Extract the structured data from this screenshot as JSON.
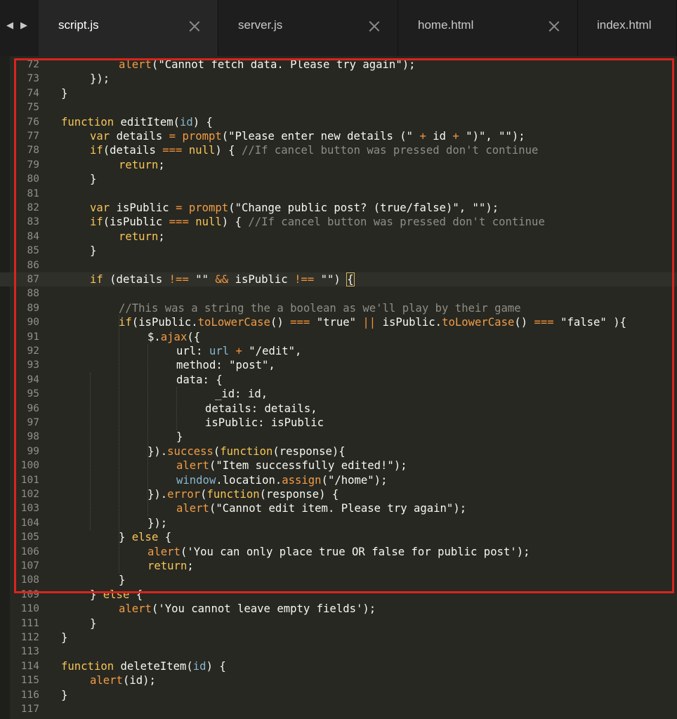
{
  "tabs": [
    {
      "label": "script.js",
      "active": true
    },
    {
      "label": "server.js",
      "active": false
    },
    {
      "label": "home.html",
      "active": false
    },
    {
      "label": "index.html",
      "active": false
    }
  ],
  "nav": {
    "back": "◀",
    "forward": "▶"
  },
  "colors": {
    "keyword": "#f8c555",
    "function": "#f39c45",
    "comment": "#8e8e85",
    "highlight": "#d8251d",
    "background": "#272822"
  },
  "lines": [
    {
      "n": "72",
      "segs": [
        [
          "f",
          "alert"
        ],
        [
          "s",
          "(\"Cannot fetch data. Please try again\");"
        ]
      ]
    },
    {
      "n": "73",
      "segs": [
        [
          "s",
          "});"
        ]
      ]
    },
    {
      "n": "74",
      "segs": [
        [
          "s",
          "}"
        ]
      ]
    },
    {
      "n": "75",
      "segs": []
    },
    {
      "n": "76",
      "segs": [
        [
          "k",
          "function "
        ],
        [
          "s",
          "editItem("
        ],
        [
          "p",
          "id"
        ],
        [
          "s",
          ") {"
        ]
      ]
    },
    {
      "n": "77",
      "segs": [
        [
          "k",
          "var "
        ],
        [
          "s",
          "details "
        ],
        [
          "o",
          "= "
        ],
        [
          "f",
          "prompt"
        ],
        [
          "s",
          "(\"Please enter new details (\" "
        ],
        [
          "o",
          "+ "
        ],
        [
          "s",
          "id "
        ],
        [
          "o",
          "+ "
        ],
        [
          "s",
          "\")\", \"\");"
        ]
      ]
    },
    {
      "n": "78",
      "segs": [
        [
          "k",
          "if"
        ],
        [
          "s",
          "(details "
        ],
        [
          "o",
          "=== "
        ],
        [
          "k",
          "null"
        ],
        [
          "s",
          ") { "
        ],
        [
          "c",
          "//If cancel button was pressed don't continue"
        ]
      ]
    },
    {
      "n": "79",
      "segs": [
        [
          "k",
          "return"
        ],
        [
          "s",
          ";"
        ]
      ]
    },
    {
      "n": "80",
      "segs": [
        [
          "s",
          "}"
        ]
      ]
    },
    {
      "n": "81",
      "segs": []
    },
    {
      "n": "82",
      "segs": [
        [
          "k",
          "var "
        ],
        [
          "s",
          "isPublic "
        ],
        [
          "o",
          "= "
        ],
        [
          "f",
          "prompt"
        ],
        [
          "s",
          "(\"Change public post? (true/false)\", \"\");"
        ]
      ]
    },
    {
      "n": "83",
      "segs": [
        [
          "k",
          "if"
        ],
        [
          "s",
          "(isPublic "
        ],
        [
          "o",
          "=== "
        ],
        [
          "k",
          "null"
        ],
        [
          "s",
          ") { "
        ],
        [
          "c",
          "//If cancel button was pressed don't continue"
        ]
      ]
    },
    {
      "n": "84",
      "segs": [
        [
          "k",
          "return"
        ],
        [
          "s",
          ";"
        ]
      ]
    },
    {
      "n": "85",
      "segs": [
        [
          "s",
          "}"
        ]
      ]
    },
    {
      "n": "86",
      "segs": []
    },
    {
      "n": "87",
      "segs": [
        [
          "k",
          "if "
        ],
        [
          "s",
          "(details "
        ],
        [
          "o",
          "!== "
        ],
        [
          "s",
          "\"\" "
        ],
        [
          "o",
          "&& "
        ],
        [
          "s",
          "isPublic "
        ],
        [
          "o",
          "!== "
        ],
        [
          "s",
          "\"\") "
        ],
        [
          "b",
          "{"
        ]
      ]
    },
    {
      "n": "88",
      "segs": []
    },
    {
      "n": "89",
      "segs": [
        [
          "c",
          "//This was a string the a boolean as we'll play by their game"
        ]
      ]
    },
    {
      "n": "90",
      "segs": [
        [
          "k",
          "if"
        ],
        [
          "s",
          "(isPublic."
        ],
        [
          "f",
          "toLowerCase"
        ],
        [
          "s",
          "() "
        ],
        [
          "o",
          "=== "
        ],
        [
          "s",
          "\"true\" "
        ],
        [
          "o",
          "|| "
        ],
        [
          "s",
          "isPublic."
        ],
        [
          "f",
          "toLowerCase"
        ],
        [
          "s",
          "() "
        ],
        [
          "o",
          "=== "
        ],
        [
          "s",
          "\"false\" ){"
        ]
      ]
    },
    {
      "n": "91",
      "segs": [
        [
          "s",
          "$."
        ],
        [
          "f",
          "ajax"
        ],
        [
          "s",
          "({"
        ]
      ]
    },
    {
      "n": "92",
      "segs": [
        [
          "s",
          "url: "
        ],
        [
          "p",
          "url "
        ],
        [
          "o",
          "+ "
        ],
        [
          "s",
          "\"/edit\","
        ]
      ]
    },
    {
      "n": "93",
      "segs": [
        [
          "s",
          "method: \"post\","
        ]
      ]
    },
    {
      "n": "94",
      "segs": [
        [
          "s",
          "data: {"
        ]
      ]
    },
    {
      "n": "95",
      "segs": [
        [
          "s",
          "_id: id,"
        ]
      ]
    },
    {
      "n": "96",
      "segs": [
        [
          "s",
          "details: details,"
        ]
      ]
    },
    {
      "n": "97",
      "segs": [
        [
          "s",
          "isPublic: isPublic"
        ]
      ]
    },
    {
      "n": "98",
      "segs": [
        [
          "s",
          "}"
        ]
      ]
    },
    {
      "n": "99",
      "segs": [
        [
          "s",
          "})."
        ],
        [
          "f",
          "success"
        ],
        [
          "s",
          "("
        ],
        [
          "k",
          "function"
        ],
        [
          "s",
          "(response){"
        ]
      ]
    },
    {
      "n": "100",
      "segs": [
        [
          "f",
          "alert"
        ],
        [
          "s",
          "(\"Item successfully edited!\");"
        ]
      ]
    },
    {
      "n": "101",
      "segs": [
        [
          "p",
          "window"
        ],
        [
          "s",
          "."
        ],
        [
          "s",
          "location."
        ],
        [
          "f",
          "assign"
        ],
        [
          "s",
          "(\"/home\");"
        ]
      ]
    },
    {
      "n": "102",
      "segs": [
        [
          "s",
          "})."
        ],
        [
          "f",
          "error"
        ],
        [
          "s",
          "("
        ],
        [
          "k",
          "function"
        ],
        [
          "s",
          "(response) {"
        ]
      ]
    },
    {
      "n": "103",
      "segs": [
        [
          "f",
          "alert"
        ],
        [
          "s",
          "(\"Cannot edit item. Please try again\");"
        ]
      ]
    },
    {
      "n": "104",
      "segs": [
        [
          "s",
          "});"
        ]
      ]
    },
    {
      "n": "105",
      "segs": [
        [
          "s",
          "} "
        ],
        [
          "k",
          "else "
        ],
        [
          "s",
          "{"
        ]
      ]
    },
    {
      "n": "106",
      "segs": [
        [
          "f",
          "alert"
        ],
        [
          "s",
          "('You can only place true OR false for public post');"
        ]
      ]
    },
    {
      "n": "107",
      "segs": [
        [
          "k",
          "return"
        ],
        [
          "s",
          ";"
        ]
      ]
    },
    {
      "n": "108",
      "segs": [
        [
          "s",
          "}"
        ]
      ]
    },
    {
      "n": "109",
      "segs": [
        [
          "s",
          "} "
        ],
        [
          "k",
          "else "
        ],
        [
          "s",
          "{"
        ]
      ]
    },
    {
      "n": "110",
      "segs": [
        [
          "f",
          "alert"
        ],
        [
          "s",
          "('You cannot leave empty fields');"
        ]
      ]
    },
    {
      "n": "111",
      "segs": [
        [
          "s",
          "}"
        ]
      ]
    },
    {
      "n": "112",
      "segs": [
        [
          "s",
          "}"
        ]
      ]
    },
    {
      "n": "113",
      "segs": []
    },
    {
      "n": "114",
      "segs": [
        [
          "k",
          "function "
        ],
        [
          "s",
          "deleteItem("
        ],
        [
          "p",
          "id"
        ],
        [
          "s",
          ") {"
        ]
      ]
    },
    {
      "n": "115",
      "segs": [
        [
          "f",
          "alert"
        ],
        [
          "s",
          "(id);"
        ]
      ]
    },
    {
      "n": "116",
      "segs": [
        [
          "s",
          "}"
        ]
      ]
    },
    {
      "n": "117",
      "segs": []
    }
  ]
}
